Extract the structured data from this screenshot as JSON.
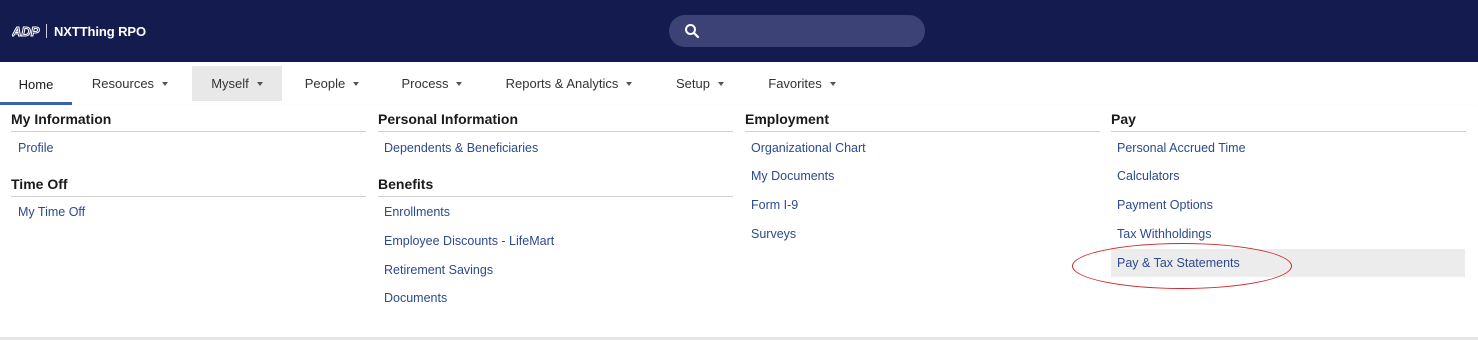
{
  "header": {
    "logo_text": "ADP",
    "company_name": "NXTThing RPO",
    "search": {
      "placeholder": "",
      "value": ""
    }
  },
  "nav": {
    "items": [
      {
        "label": "Home"
      },
      {
        "label": "Resources"
      },
      {
        "label": "Myself"
      },
      {
        "label": "People"
      },
      {
        "label": "Process"
      },
      {
        "label": "Reports & Analytics"
      },
      {
        "label": "Setup"
      },
      {
        "label": "Favorites"
      }
    ],
    "active": "Home",
    "open": "Myself"
  },
  "menu": {
    "my_information": {
      "title": "My Information",
      "links": [
        "Profile"
      ]
    },
    "time_off": {
      "title": "Time Off",
      "links": [
        "My Time Off"
      ]
    },
    "personal_information": {
      "title": "Personal Information",
      "links": [
        "Dependents & Beneficiaries"
      ]
    },
    "benefits": {
      "title": "Benefits",
      "links": [
        "Enrollments",
        "Employee Discounts - LifeMart",
        "Retirement Savings",
        "Documents"
      ]
    },
    "employment": {
      "title": "Employment",
      "links": [
        "Organizational Chart",
        "My Documents",
        "Form I-9",
        "Surveys"
      ]
    },
    "pay": {
      "title": "Pay",
      "links": [
        "Personal Accrued Time",
        "Calculators",
        "Payment Options",
        "Tax Withholdings",
        "Pay & Tax Statements"
      ]
    }
  },
  "colors": {
    "header_bg": "#131b4f",
    "search_bg": "#3c4276",
    "link": "#2c4a8f",
    "active_underline": "#3b62b1",
    "annotation": "#cc2a2a"
  }
}
